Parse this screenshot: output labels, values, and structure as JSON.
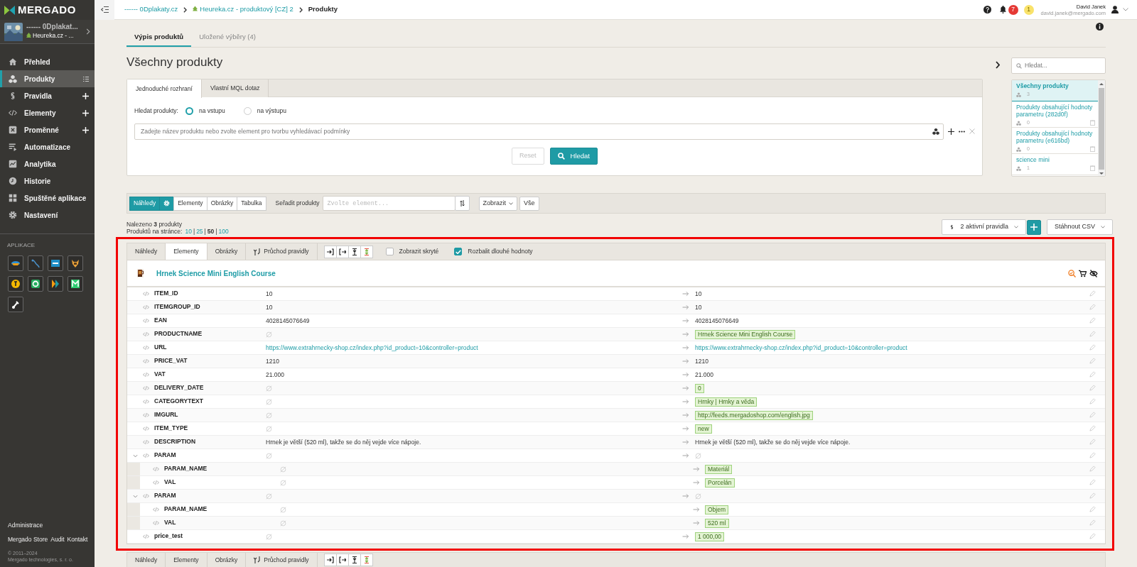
{
  "sidebar": {
    "logo": "MERGADO",
    "project": {
      "name": "------ 0Dplakat...",
      "feed": "Heureka.cz - ..."
    },
    "items": [
      {
        "label": "Přehled",
        "selected": false,
        "addable": false,
        "list_view": false
      },
      {
        "label": "Produkty",
        "selected": true,
        "addable": false,
        "list_view": true
      },
      {
        "label": "Pravidla",
        "selected": false,
        "addable": true,
        "list_view": false
      },
      {
        "label": "Elementy",
        "selected": false,
        "addable": true,
        "list_view": false
      },
      {
        "label": "Proměnné",
        "selected": false,
        "addable": true,
        "list_view": false
      },
      {
        "label": "Automatizace",
        "selected": false,
        "addable": false,
        "list_view": false
      },
      {
        "label": "Analytika",
        "selected": false,
        "addable": false,
        "list_view": false
      },
      {
        "label": "Historie",
        "selected": false,
        "addable": false,
        "list_view": false
      },
      {
        "label": "Spuštěné aplikace",
        "selected": false,
        "addable": false,
        "list_view": false
      },
      {
        "label": "Nastavení",
        "selected": false,
        "addable": false,
        "list_view": false
      }
    ],
    "apps_heading": "APLIKACE",
    "admin": "Administrace",
    "links": [
      "Mergado Store",
      "Audit",
      "Kontakt"
    ],
    "copyright": "© 2011–2024",
    "company": "Mergado technologies, s. r. o."
  },
  "topbar": {
    "breadcrumbs": [
      {
        "text": "------ 0Dplakaty.cz",
        "kind": "project"
      },
      {
        "text": "Heureka.cz - produktový [CZ] 2",
        "kind": "feed"
      },
      {
        "text": "Produkty",
        "kind": "current"
      }
    ],
    "notifications": "7",
    "alerts": "1",
    "user": {
      "name": "David Janek",
      "email": "david.janek@mergado.com"
    }
  },
  "tabs": [
    {
      "label": "Výpis produktů",
      "selected": true
    },
    {
      "label": "Uložené výběry (4)",
      "selected": false
    }
  ],
  "title": "Všechny produkty",
  "search": {
    "tabs": [
      {
        "label": "Jednoduché rozhraní",
        "selected": true
      },
      {
        "label": "Vlastní MQL dotaz",
        "selected": false
      }
    ],
    "label": "Hledat produkty:",
    "options": [
      {
        "label": "na vstupu",
        "selected": true
      },
      {
        "label": "na výstupu",
        "selected": false
      }
    ],
    "placeholder": "Zadejte název produktu nebo zvolte element pro tvorbu vyhledávací podmínky",
    "reset": {
      "label": "Reset",
      "disabled": true
    },
    "submit": "Hledat"
  },
  "saved": {
    "placeholder": "Hledat...",
    "items": [
      {
        "title": "Všechny produkty",
        "count": "3",
        "selected": true,
        "deletable": false
      },
      {
        "title": "Produkty obsahující hodnoty parametru (282d0f)",
        "count": "0",
        "selected": false,
        "deletable": true
      },
      {
        "title": "Produkty obsahující hodnoty parametru (e616bd)",
        "count": "0",
        "selected": false,
        "deletable": true
      },
      {
        "title": "science mini",
        "count": "1",
        "selected": false,
        "deletable": true
      }
    ]
  },
  "toolbar": {
    "views": [
      {
        "label": "Náhledy",
        "selected": true
      },
      {
        "label": "Elementy",
        "selected": false
      },
      {
        "label": "Obrázky",
        "selected": false
      },
      {
        "label": "Tabulka",
        "selected": false
      }
    ],
    "sort_label": "Seřadit produkty",
    "sort_placeholder": "Zvolte element...",
    "show": "Zobrazit",
    "all": "Vše"
  },
  "summary": {
    "found": "Nalezeno **3** produkty",
    "per_page_label": "Produktů na stránce:",
    "separator": "|",
    "per_page": [
      {
        "label": "10",
        "selected": false
      },
      {
        "label": "25",
        "selected": false
      },
      {
        "label": "50",
        "selected": true
      },
      {
        "label": "100",
        "selected": false
      }
    ]
  },
  "actions": {
    "rules": "2 aktivní pravidla",
    "download": "Stáhnout CSV"
  },
  "panel": {
    "highlighted": true,
    "tabs": [
      {
        "label": "Náhledy",
        "selected": false
      },
      {
        "label": "Elementy",
        "selected": true
      },
      {
        "label": "Obrázky",
        "selected": false
      },
      {
        "label": "Průchod pravidly",
        "selected": false,
        "kind": "rules"
      }
    ],
    "options": [
      {
        "label": "Zobrazit skryté",
        "checked": false
      },
      {
        "label": "Rozbalit dlouhé hodnoty",
        "checked": true
      }
    ],
    "product": "Hrnek Science Mini English Course",
    "rows": [
      {
        "name": "ITEM_ID",
        "input": {
          "kind": "text",
          "text": "10"
        },
        "output": {
          "kind": "text",
          "text": "10",
          "changed": false
        }
      },
      {
        "name": "ITEMGROUP_ID",
        "input": {
          "kind": "text",
          "text": "10"
        },
        "output": {
          "kind": "text",
          "text": "10",
          "changed": false
        }
      },
      {
        "name": "EAN",
        "input": {
          "kind": "text",
          "text": "4028145076649"
        },
        "output": {
          "kind": "text",
          "text": "4028145076649",
          "changed": false
        }
      },
      {
        "name": "PRODUCTNAME",
        "input": {
          "kind": "empty"
        },
        "output": {
          "kind": "text",
          "text": "Hrnek Science Mini English Course",
          "changed": true
        }
      },
      {
        "name": "URL",
        "input": {
          "kind": "link",
          "text": "https://www.extrahrnecky-shop.cz/index.php?id_product=10&controller=product"
        },
        "output": {
          "kind": "link",
          "text": "https://www.extrahrnecky-shop.cz/index.php?id_product=10&controller=product",
          "changed": false
        }
      },
      {
        "name": "PRICE_VAT",
        "input": {
          "kind": "text",
          "text": "1210"
        },
        "output": {
          "kind": "text",
          "text": "1210",
          "changed": false
        }
      },
      {
        "name": "VAT",
        "input": {
          "kind": "text",
          "text": "21.000"
        },
        "output": {
          "kind": "text",
          "text": "21.000",
          "changed": false
        }
      },
      {
        "name": "DELIVERY_DATE",
        "input": {
          "kind": "empty"
        },
        "output": {
          "kind": "text",
          "text": "0",
          "changed": true
        }
      },
      {
        "name": "CATEGORYTEXT",
        "input": {
          "kind": "empty"
        },
        "output": {
          "kind": "text",
          "text": "Hrnky | Hrnky a věda",
          "changed": true
        }
      },
      {
        "name": "IMGURL",
        "input": {
          "kind": "empty"
        },
        "output": {
          "kind": "text",
          "text": "http://feeds.mergadoshop.com/english.jpg",
          "changed": true
        }
      },
      {
        "name": "ITEM_TYPE",
        "input": {
          "kind": "empty"
        },
        "output": {
          "kind": "text",
          "text": "new",
          "changed": true
        }
      },
      {
        "name": "DESCRIPTION",
        "input": {
          "kind": "text",
          "text": "Hrnek je větší (520 ml), takže se do něj vejde více nápoje."
        },
        "output": {
          "kind": "text",
          "text": "Hrnek je větší (520 ml), takže se do něj vejde více nápoje.",
          "changed": false
        }
      },
      {
        "name": "PARAM",
        "expanded": true,
        "input": {
          "kind": "empty"
        },
        "output": {
          "kind": "empty"
        },
        "children": [
          {
            "name": "PARAM_NAME",
            "input": {
              "kind": "empty"
            },
            "output": {
              "kind": "text",
              "text": "Materiál",
              "changed": true
            }
          },
          {
            "name": "VAL",
            "input": {
              "kind": "empty"
            },
            "output": {
              "kind": "text",
              "text": "Porcelán",
              "changed": true
            }
          }
        ]
      },
      {
        "name": "PARAM",
        "expanded": true,
        "input": {
          "kind": "empty"
        },
        "output": {
          "kind": "empty"
        },
        "children": [
          {
            "name": "PARAM_NAME",
            "input": {
              "kind": "empty"
            },
            "output": {
              "kind": "text",
              "text": "Objem",
              "changed": true
            }
          },
          {
            "name": "VAL",
            "input": {
              "kind": "empty"
            },
            "output": {
              "kind": "text",
              "text": "520 ml",
              "changed": true
            }
          }
        ]
      },
      {
        "name": "price_test",
        "input": {
          "kind": "empty"
        },
        "output": {
          "kind": "text",
          "text": "1 000,00",
          "changed": true
        }
      }
    ]
  },
  "next_panel": {
    "tabs": [
      "Náhledy",
      "Elementy",
      "Obrázky",
      "Průchod pravidly"
    ]
  }
}
